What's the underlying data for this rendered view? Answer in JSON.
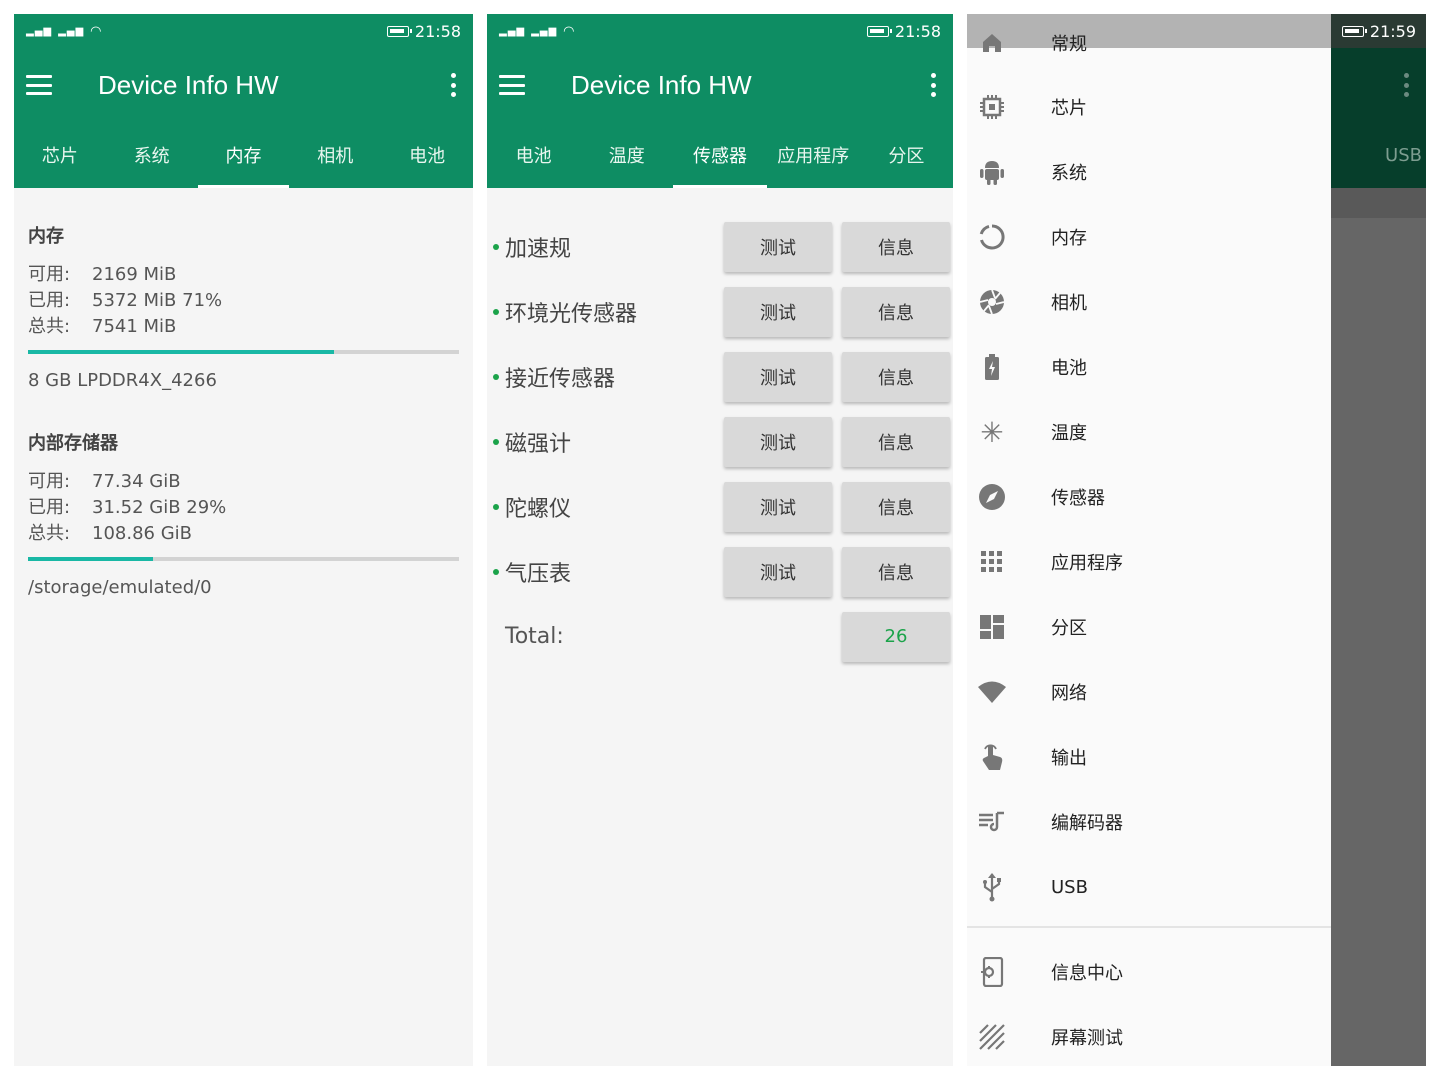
{
  "status": {
    "time_left": "21:58",
    "time_right": "21:59",
    "indicators": "4G 4G HD"
  },
  "app": {
    "title": "Device Info HW"
  },
  "screen1": {
    "tabs": [
      "芯片",
      "系统",
      "内存",
      "相机",
      "电池"
    ],
    "active_tab": 2,
    "memory": {
      "title": "内存",
      "available_label": "可用:",
      "available": "2169 MiB",
      "used_label": "已用:",
      "used": "5372 MiB 71%",
      "total_label": "总共:",
      "total": "7541 MiB",
      "usage_fraction": 0.71,
      "type": "8 GB LPDDR4X_4266"
    },
    "storage": {
      "title": "内部存储器",
      "available_label": "可用:",
      "available": "77.34 GiB",
      "used_label": "已用:",
      "used": "31.52 GiB 29%",
      "total_label": "总共:",
      "total": "108.86 GiB",
      "usage_fraction": 0.29,
      "path": "/storage/emulated/0"
    }
  },
  "screen2": {
    "tabs": [
      "电池",
      "温度",
      "传感器",
      "应用程序",
      "分区"
    ],
    "active_tab": 2,
    "test_label": "测试",
    "info_label": "信息",
    "sensors": [
      "加速规",
      "环境光传感器",
      "接近传感器",
      "磁强计",
      "陀螺仪",
      "气压表"
    ],
    "total_label": "Total:",
    "total_value": "26"
  },
  "screen3": {
    "drawer_items": [
      {
        "label": "常规",
        "icon": "home-icon"
      },
      {
        "label": "芯片",
        "icon": "chip-icon"
      },
      {
        "label": "系统",
        "icon": "android-icon"
      },
      {
        "label": "内存",
        "icon": "memory-ring-icon"
      },
      {
        "label": "相机",
        "icon": "camera-aperture-icon"
      },
      {
        "label": "电池",
        "icon": "battery-icon"
      },
      {
        "label": "温度",
        "icon": "snowflake-icon"
      },
      {
        "label": "传感器",
        "icon": "compass-icon"
      },
      {
        "label": "应用程序",
        "icon": "apps-grid-icon"
      },
      {
        "label": "分区",
        "icon": "dashboard-icon"
      },
      {
        "label": "网络",
        "icon": "wifi-icon"
      },
      {
        "label": "输出",
        "icon": "touch-icon"
      },
      {
        "label": "编解码器",
        "icon": "music-list-icon"
      },
      {
        "label": "USB",
        "icon": "usb-icon"
      }
    ],
    "footer_items": [
      {
        "label": "信息中心",
        "icon": "device-settings-icon"
      },
      {
        "label": "屏幕测试",
        "icon": "stripes-icon"
      }
    ],
    "background_tab": "USB"
  },
  "colors": {
    "primary": "#0e8d63",
    "progress": "#19b8a5",
    "total_value": "#1ba34a"
  }
}
